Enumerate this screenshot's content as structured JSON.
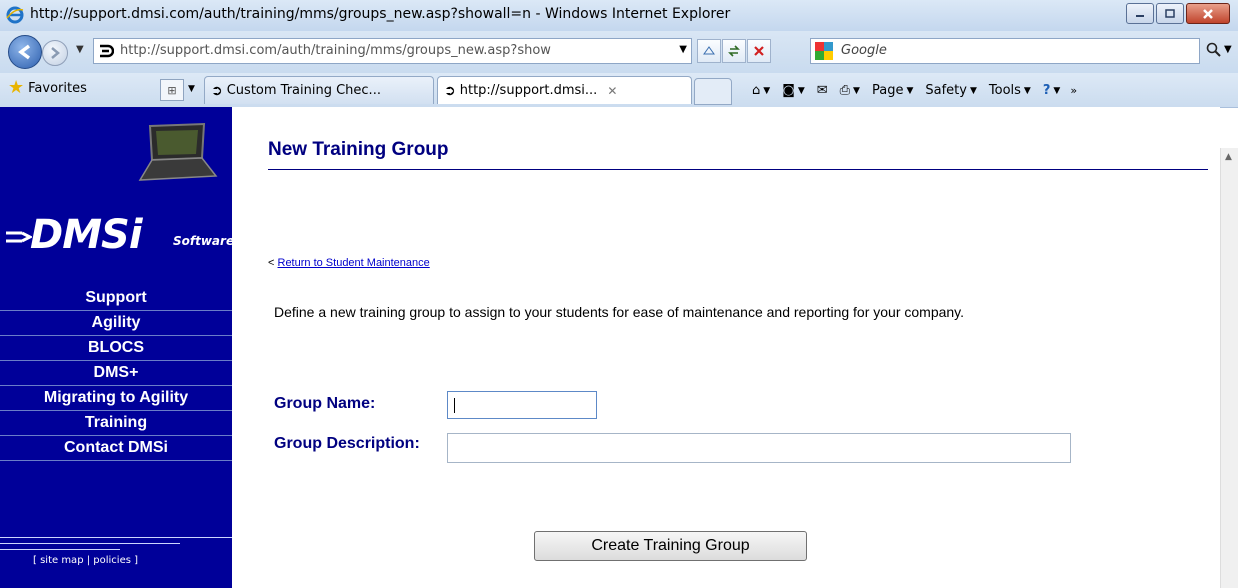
{
  "window": {
    "title": "http://support.dmsi.com/auth/training/mms/groups_new.asp?showall=n - Windows Internet Explorer"
  },
  "address_bar": {
    "url": "http://support.dmsi.com/auth/training/mms/groups_new.asp?show",
    "search_placeholder": "Google"
  },
  "toolbar": {
    "favorites_label": "Favorites",
    "tabs": [
      {
        "label": "Custom Training Chec...",
        "active": false
      },
      {
        "label": "http://support.dmsi...",
        "active": true
      }
    ],
    "commands": {
      "page": "Page",
      "safety": "Safety",
      "tools": "Tools"
    }
  },
  "sidebar": {
    "logo_text": "DMSi",
    "logo_sub": "Software",
    "nav_items": [
      "Support",
      "Agility",
      "BLOCS",
      "DMS+",
      "Migrating to Agility",
      "Training",
      "Contact DMSi"
    ],
    "footer_links": "[ site map | policies ]"
  },
  "main": {
    "title": "New Training Group",
    "return_prefix": "<",
    "return_link": "Return to Student Maintenance",
    "intro": "Define a new training group to assign to your students for ease of maintenance and reporting for your company.",
    "group_name_label": "Group Name:",
    "group_name_value": "",
    "group_description_label": "Group Description:",
    "group_description_value": "",
    "submit_label": "Create Training Group"
  },
  "colors": {
    "sidebar_bg": "#000099",
    "title_color": "#000080"
  }
}
